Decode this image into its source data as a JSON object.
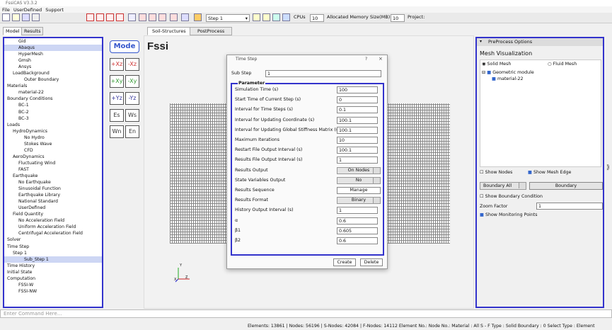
{
  "window_title": "FssiCAS V3.3.2",
  "menu": [
    "File",
    "UserDefined",
    "Support"
  ],
  "toolbar": {
    "step_select": "Step 1",
    "cpus_label": "CPUs",
    "cpus_value": "10",
    "memory_label": "Allocated Memory Size(MB) :",
    "memory_value": "10",
    "project_label": "Project:"
  },
  "left_tabs": [
    "Model",
    "Results"
  ],
  "tree": [
    {
      "label": "Gid",
      "indent": 2
    },
    {
      "label": "Abaqus",
      "indent": 2,
      "highlight": true
    },
    {
      "label": "HyperMesh",
      "indent": 2
    },
    {
      "label": "Gmsh",
      "indent": 2
    },
    {
      "label": "Ansys",
      "indent": 2
    },
    {
      "label": "LoadBackground",
      "indent": 1
    },
    {
      "label": "Outer Boundary",
      "indent": 3
    },
    {
      "label": "Materials",
      "indent": 0
    },
    {
      "label": "material-22",
      "indent": 2
    },
    {
      "label": "Boundary Conditions",
      "indent": 0
    },
    {
      "label": "BC-1",
      "indent": 2
    },
    {
      "label": "BC-2",
      "indent": 2
    },
    {
      "label": "BC-3",
      "indent": 2
    },
    {
      "label": "Loads",
      "indent": 0
    },
    {
      "label": "HydroDynamics",
      "indent": 1
    },
    {
      "label": "No Hydro",
      "indent": 3
    },
    {
      "label": "Stokes Wave",
      "indent": 3
    },
    {
      "label": "CFD",
      "indent": 3
    },
    {
      "label": "AeroDynamics",
      "indent": 1
    },
    {
      "label": "Fluctuating Wind",
      "indent": 2
    },
    {
      "label": "FAST",
      "indent": 2
    },
    {
      "label": "Earthquake",
      "indent": 1
    },
    {
      "label": "No Earthquake",
      "indent": 2
    },
    {
      "label": "Sinusoidal Function",
      "indent": 2
    },
    {
      "label": "Earthquake Library",
      "indent": 2
    },
    {
      "label": "National Standard",
      "indent": 2
    },
    {
      "label": "UserDefined",
      "indent": 2
    },
    {
      "label": "Field Quantity",
      "indent": 1
    },
    {
      "label": "No Acceleration Field",
      "indent": 2
    },
    {
      "label": "Uniform Acceleration Field",
      "indent": 2
    },
    {
      "label": "Centrifugal Acceleration Field",
      "indent": 2
    },
    {
      "label": "Solver",
      "indent": 0
    },
    {
      "label": "Time Step",
      "indent": 0
    },
    {
      "label": "Step 1",
      "indent": 1
    },
    {
      "label": "Sub_Step 1",
      "indent": 3,
      "highlight": true
    },
    {
      "label": "Time History",
      "indent": 0
    },
    {
      "label": "Initial State",
      "indent": 0
    },
    {
      "label": "Computation",
      "indent": 0
    },
    {
      "label": "FSSI-W",
      "indent": 2
    },
    {
      "label": "FSSI-NW",
      "indent": 2
    }
  ],
  "center_tabs": [
    "Soil-Structures",
    "PostProcess"
  ],
  "logo_text": "Fssi",
  "mode_button": "Mode",
  "icon_buttons": [
    "+Xz",
    "-Xz",
    "+Xy",
    "-Xy",
    "+Yz",
    "-Yz",
    "Es",
    "Ws",
    "Wn",
    "En"
  ],
  "axes": {
    "y": "Y",
    "z": "Z",
    "x": "X"
  },
  "dialog": {
    "title": "Time Step",
    "help": "?",
    "close": "×",
    "substep_label": "Sub Step",
    "substep_value": "1",
    "group_label": "Parameter",
    "fields": [
      {
        "label": "Simulation Time (s)",
        "value": "100",
        "kind": "input"
      },
      {
        "label": "Start Time of Current Step (s)",
        "value": "0",
        "kind": "input"
      },
      {
        "label": "Interval for Time Steps (s)",
        "value": "0.1",
        "kind": "input"
      },
      {
        "label": "Interval for Updating Coordinate (s)",
        "value": "100.1",
        "kind": "input"
      },
      {
        "label": "Interval for Updating Global Stiffness Matrix (s)",
        "value": "100.1",
        "kind": "input"
      },
      {
        "label": "Maximum Iterations",
        "value": "10",
        "kind": "input"
      },
      {
        "label": "Restart File Output Interval (s)",
        "value": "100.1",
        "kind": "input"
      },
      {
        "label": "Results File Output Interval (s)",
        "value": "1",
        "kind": "input"
      },
      {
        "label": "Results Output",
        "value": "On Nodes",
        "kind": "dropdown"
      },
      {
        "label": "State Variables Output",
        "value": "No",
        "kind": "dropdown"
      },
      {
        "label": "Results Sequence",
        "value": "Manage",
        "kind": "button"
      },
      {
        "label": "Results Format",
        "value": "Binary",
        "kind": "dropdown"
      },
      {
        "label": "History Output Interval (s)",
        "value": "1",
        "kind": "input_wide"
      },
      {
        "label": "α",
        "value": "0.6",
        "kind": "input_wide"
      },
      {
        "label": "β1",
        "value": "0.605",
        "kind": "input_wide"
      },
      {
        "label": "β2",
        "value": "0.6",
        "kind": "input_wide"
      }
    ],
    "create_label": "Create",
    "delete_label": "Delete"
  },
  "right_panel": {
    "header": "PreProcess Options",
    "section": "Mesh Visualization",
    "solid_mesh": "Solid Mesh",
    "fluid_mesh": "Fluid Mesh",
    "geo_module": "Geometric module",
    "material": "material-22",
    "show_nodes": "Show Nodes",
    "show_mesh_edge": "Show Mesh Edge",
    "boundary_all": "Boundary All",
    "boundary_btn": "Boundary",
    "show_boundary_condition": "Show Boundary Condition",
    "zoom_label": "Zoom Factor",
    "zoom_value": "1",
    "show_monitoring": "Show Monitoring Points"
  },
  "command_placeholder": "Enter Command Here...",
  "status_bar": "Elements: 13861 | Nodes: 56196 | S-Nodes: 42084 | F-Nodes: 14112  Element No.:   Node No.:   Material :  All   S - F Type :  Solid   Boundary :  0   Select Type :  Element",
  "colors": {
    "accent_border": "#3333cc",
    "highlight": "#cdd6f4"
  }
}
